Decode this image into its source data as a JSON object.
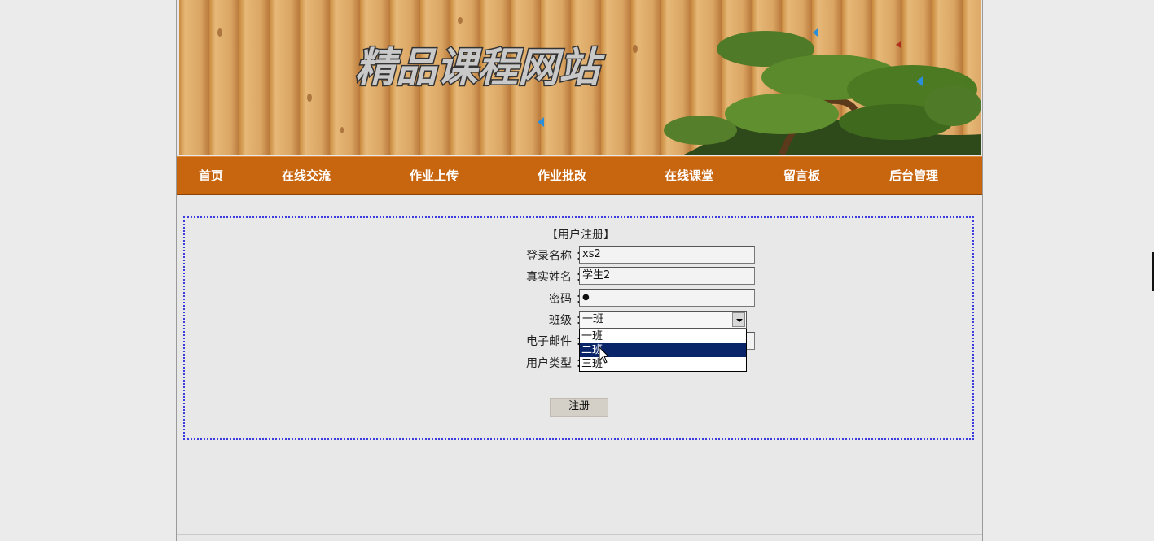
{
  "site": {
    "banner_title": "精品课程网站"
  },
  "nav": {
    "items": [
      {
        "label": "首页"
      },
      {
        "label": "在线交流"
      },
      {
        "label": "作业上传"
      },
      {
        "label": "作业批改"
      },
      {
        "label": "在线课堂"
      },
      {
        "label": "留言板"
      },
      {
        "label": "后台管理"
      }
    ]
  },
  "form": {
    "title": "【用户注册】",
    "colon": "：",
    "fields": {
      "login_name": {
        "label": "登录名称",
        "value": "xs2"
      },
      "real_name": {
        "label": "真实姓名",
        "value": "学生2"
      },
      "password": {
        "label": "密码",
        "value": "●"
      },
      "class": {
        "label": "班级",
        "value": "一班"
      },
      "email": {
        "label": "电子邮件",
        "value": ""
      },
      "user_type": {
        "label": "用户类型",
        "value": ""
      }
    },
    "class_options": [
      "一班",
      "二班",
      "三班"
    ],
    "highlighted_option_index": 1,
    "submit_label": "注册"
  },
  "colors": {
    "nav_background": "#c8650f",
    "form_border": "#3a3adf",
    "dropdown_highlight": "#0a246a"
  }
}
